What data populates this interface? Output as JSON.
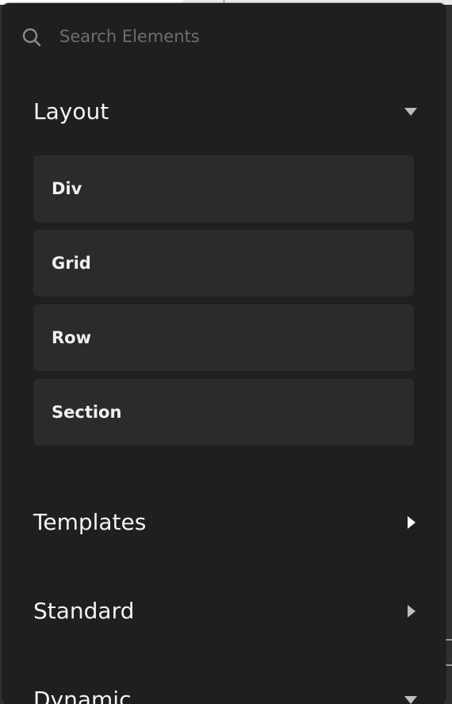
{
  "search": {
    "placeholder": "Search Elements",
    "value": "",
    "icon": "search-icon"
  },
  "sections": [
    {
      "title": "Layout",
      "state": "expanded",
      "caret_icon": "triangle-down-icon",
      "items": [
        {
          "label": "Div"
        },
        {
          "label": "Grid"
        },
        {
          "label": "Row"
        },
        {
          "label": "Section"
        }
      ]
    },
    {
      "title": "Templates",
      "state": "collapsed",
      "caret_icon": "triangle-right-icon"
    },
    {
      "title": "Standard",
      "state": "collapsed",
      "caret_icon": "triangle-right-icon"
    },
    {
      "title": "Dynamic",
      "state": "expanded",
      "caret_icon": "triangle-down-icon"
    }
  ],
  "colors": {
    "panel_background": "#1f1f1f",
    "item_background": "#2b2b2b",
    "text_primary": "#f2f2f2",
    "placeholder": "#6e6e6e",
    "caret_collapsed": "#ffffff",
    "caret_expanded": "#bdbdbd"
  }
}
